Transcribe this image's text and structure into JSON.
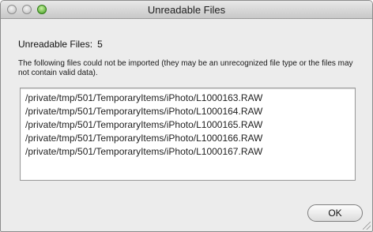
{
  "window": {
    "title": "Unreadable Files"
  },
  "dialog": {
    "heading_label": "Unreadable Files:",
    "count": "5",
    "description": "The following files could not be imported (they may be an unrecognized file type or the files may not contain valid data).",
    "files": [
      "/private/tmp/501/TemporaryItems/iPhoto/L1000163.RAW",
      "/private/tmp/501/TemporaryItems/iPhoto/L1000164.RAW",
      "/private/tmp/501/TemporaryItems/iPhoto/L1000165.RAW",
      "/private/tmp/501/TemporaryItems/iPhoto/L1000166.RAW",
      "/private/tmp/501/TemporaryItems/iPhoto/L1000167.RAW"
    ],
    "ok_label": "OK"
  }
}
